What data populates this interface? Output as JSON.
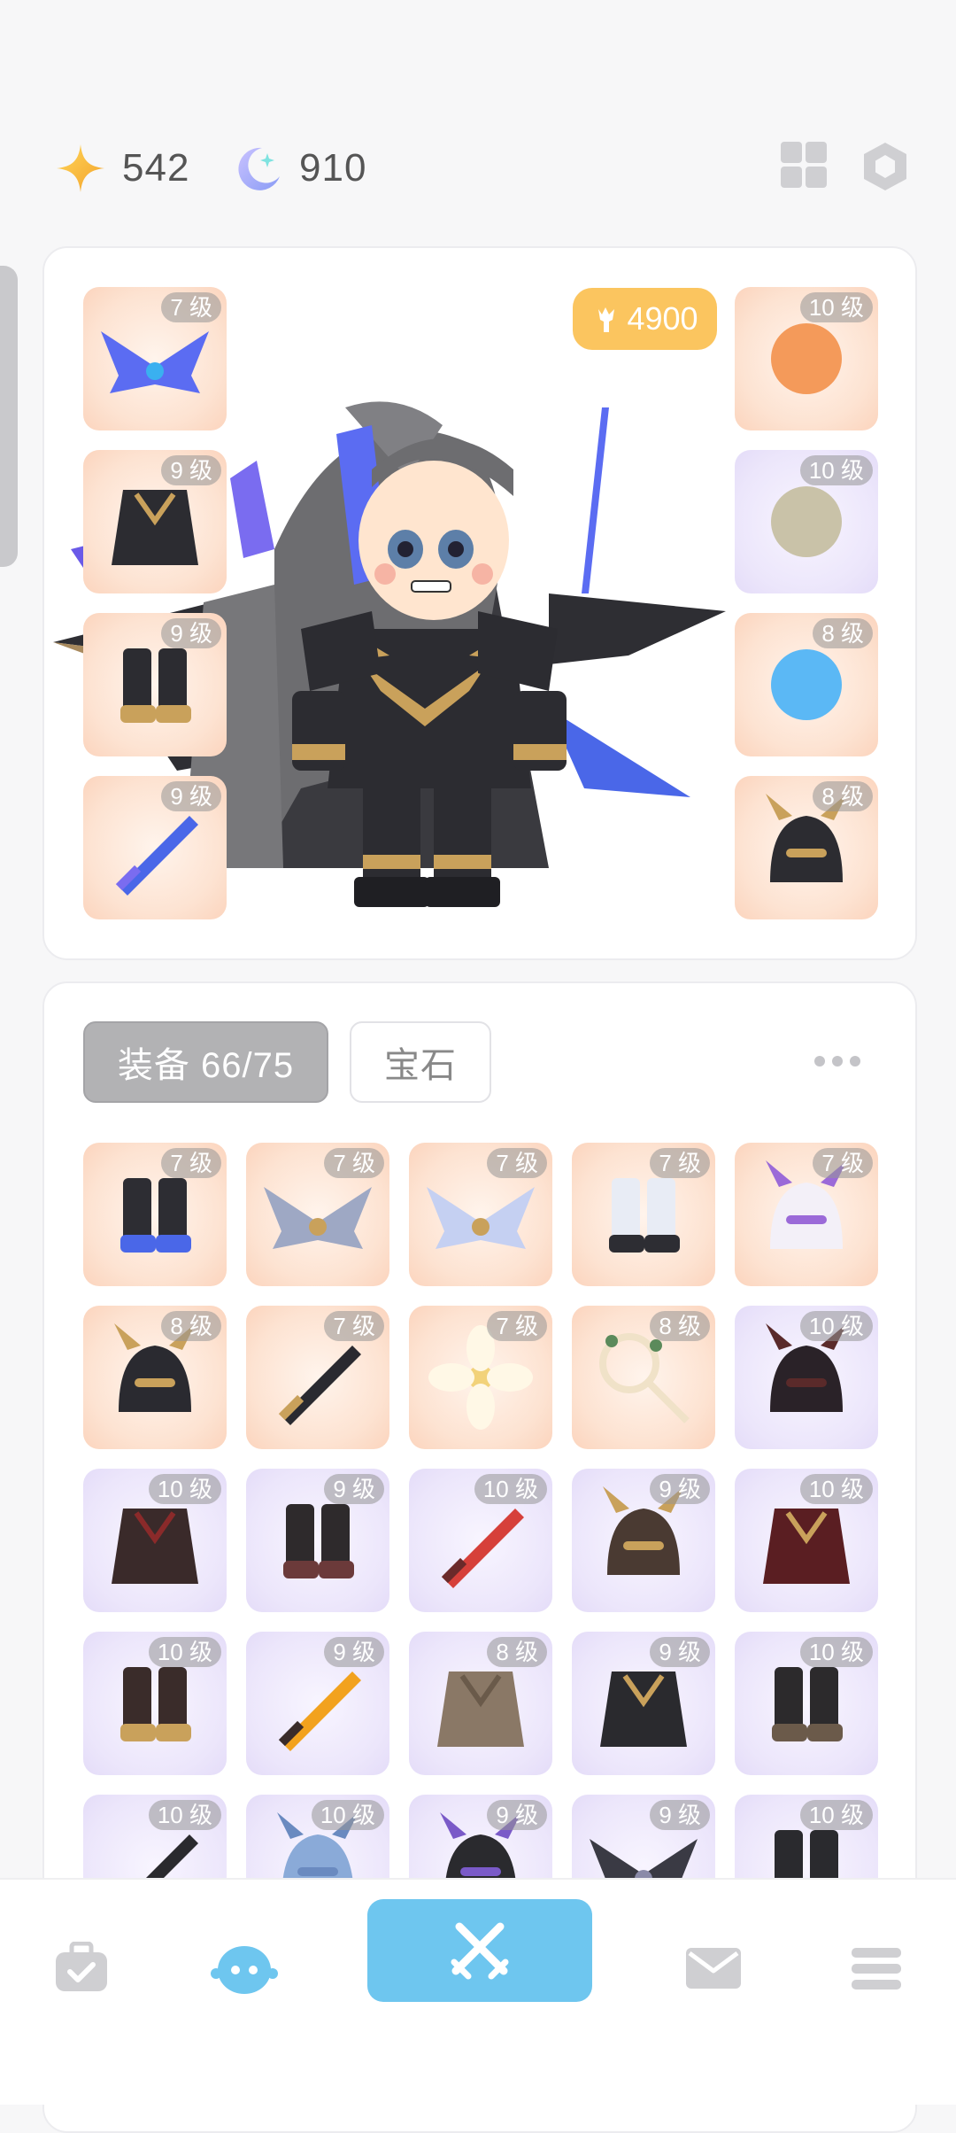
{
  "currency": {
    "stars": "542",
    "moons": "910"
  },
  "character": {
    "power": "4900",
    "left_slots": [
      {
        "level": "7 级",
        "icon": "butterfly-wings-icon",
        "rarity": "orange"
      },
      {
        "level": "9 级",
        "icon": "dark-armor-icon",
        "rarity": "orange"
      },
      {
        "level": "9 级",
        "icon": "boots-icon",
        "rarity": "orange"
      },
      {
        "level": "9 级",
        "icon": "blue-sword-icon",
        "rarity": "orange"
      }
    ],
    "right_slots": [
      {
        "level": "10 级",
        "icon": "piano-icon",
        "rarity": "orange"
      },
      {
        "level": "10 级",
        "icon": "dragon-ring-icon",
        "rarity": "purple"
      },
      {
        "level": "8 级",
        "icon": "crescent-moon-icon",
        "rarity": "orange"
      },
      {
        "level": "8 级",
        "icon": "dragon-helmet-icon",
        "rarity": "orange"
      }
    ]
  },
  "inventory": {
    "tab_equipment": "装备 66/75",
    "tab_gems": "宝石",
    "items": [
      {
        "level": "7 级",
        "icon": "crystal-boots-icon",
        "rarity": "orange",
        "color": "#2d2d33",
        "accent": "#4a67e8"
      },
      {
        "level": "7 级",
        "icon": "winged-helmet-icon",
        "rarity": "orange",
        "color": "#9ea8c4",
        "accent": "#c9a15b"
      },
      {
        "level": "7 级",
        "icon": "angel-wings-icon",
        "rarity": "orange",
        "color": "#c5d0f2",
        "accent": "#c9a15b"
      },
      {
        "level": "7 级",
        "icon": "white-boots-icon",
        "rarity": "orange",
        "color": "#e8ecf5",
        "accent": "#2d2d33"
      },
      {
        "level": "7 级",
        "icon": "cat-mask-icon",
        "rarity": "orange",
        "color": "#f3f0f8",
        "accent": "#9b6ad8"
      },
      {
        "level": "8 级",
        "icon": "horned-helmet-icon",
        "rarity": "orange",
        "color": "#2a2a30",
        "accent": "#c9a15b"
      },
      {
        "level": "7 级",
        "icon": "scythe-icon",
        "rarity": "orange",
        "color": "#2a2a30",
        "accent": "#c9a15b"
      },
      {
        "level": "7 级",
        "icon": "lily-flower-icon",
        "rarity": "orange",
        "color": "#fff8e6",
        "accent": "#f2d27a"
      },
      {
        "level": "8 级",
        "icon": "floral-staff-icon",
        "rarity": "orange",
        "color": "#f0e2c8",
        "accent": "#5b8a5b"
      },
      {
        "level": "10 级",
        "icon": "bat-hood-icon",
        "rarity": "purple",
        "color": "#2a2228",
        "accent": "#5a2a2a"
      },
      {
        "level": "10 级",
        "icon": "demon-armor-icon",
        "rarity": "purple",
        "color": "#3a2a2a",
        "accent": "#8a2a2a"
      },
      {
        "level": "9 级",
        "icon": "dark-boots-icon",
        "rarity": "purple",
        "color": "#2e2a2c",
        "accent": "#6b3a3a"
      },
      {
        "level": "10 级",
        "icon": "flame-sword-icon",
        "rarity": "purple",
        "color": "#d6403a",
        "accent": "#6b2a2a"
      },
      {
        "level": "9 级",
        "icon": "horned-mask-icon",
        "rarity": "purple",
        "color": "#4a3a32",
        "accent": "#c9a15b"
      },
      {
        "level": "10 级",
        "icon": "crimson-cape-icon",
        "rarity": "purple",
        "color": "#5a1e22",
        "accent": "#c9a15b"
      },
      {
        "level": "10 级",
        "icon": "leather-boots-icon",
        "rarity": "purple",
        "color": "#3a2c2a",
        "accent": "#c9a15b"
      },
      {
        "level": "9 级",
        "icon": "fire-hammer-icon",
        "rarity": "purple",
        "color": "#f2a21e",
        "accent": "#3a2c2a"
      },
      {
        "level": "8 级",
        "icon": "straw-skirt-icon",
        "rarity": "purple",
        "color": "#8a7866",
        "accent": "#6a5a4a"
      },
      {
        "level": "9 级",
        "icon": "dark-robe-icon",
        "rarity": "purple",
        "color": "#2a2a2e",
        "accent": "#c9a15b"
      },
      {
        "level": "10 级",
        "icon": "black-boots-icon",
        "rarity": "purple",
        "color": "#2c2a2c",
        "accent": "#6b5a4a"
      },
      {
        "level": "10 级",
        "icon": "katana-icon",
        "rarity": "purple",
        "color": "#2a2a2e",
        "accent": "#8a8a8a"
      },
      {
        "level": "10 级",
        "icon": "wizard-hat-icon",
        "rarity": "purple",
        "color": "#8aaad8",
        "accent": "#6a8ac0"
      },
      {
        "level": "9 级",
        "icon": "purple-horns-icon",
        "rarity": "purple",
        "color": "#2a2a2e",
        "accent": "#7a5ac8"
      },
      {
        "level": "9 级",
        "icon": "bat-wings-icon",
        "rarity": "purple",
        "color": "#3a3a44",
        "accent": "#8a8aa8"
      },
      {
        "level": "10 级",
        "icon": "purple-boots-icon",
        "rarity": "purple",
        "color": "#2a2a2e",
        "accent": "#7a5ac8"
      }
    ]
  },
  "nav": {
    "items": [
      "bag-icon",
      "character-icon",
      "battle-icon",
      "mail-icon",
      "menu-icon"
    ],
    "active": "battle-icon",
    "active_color": "#6ec6ef"
  }
}
